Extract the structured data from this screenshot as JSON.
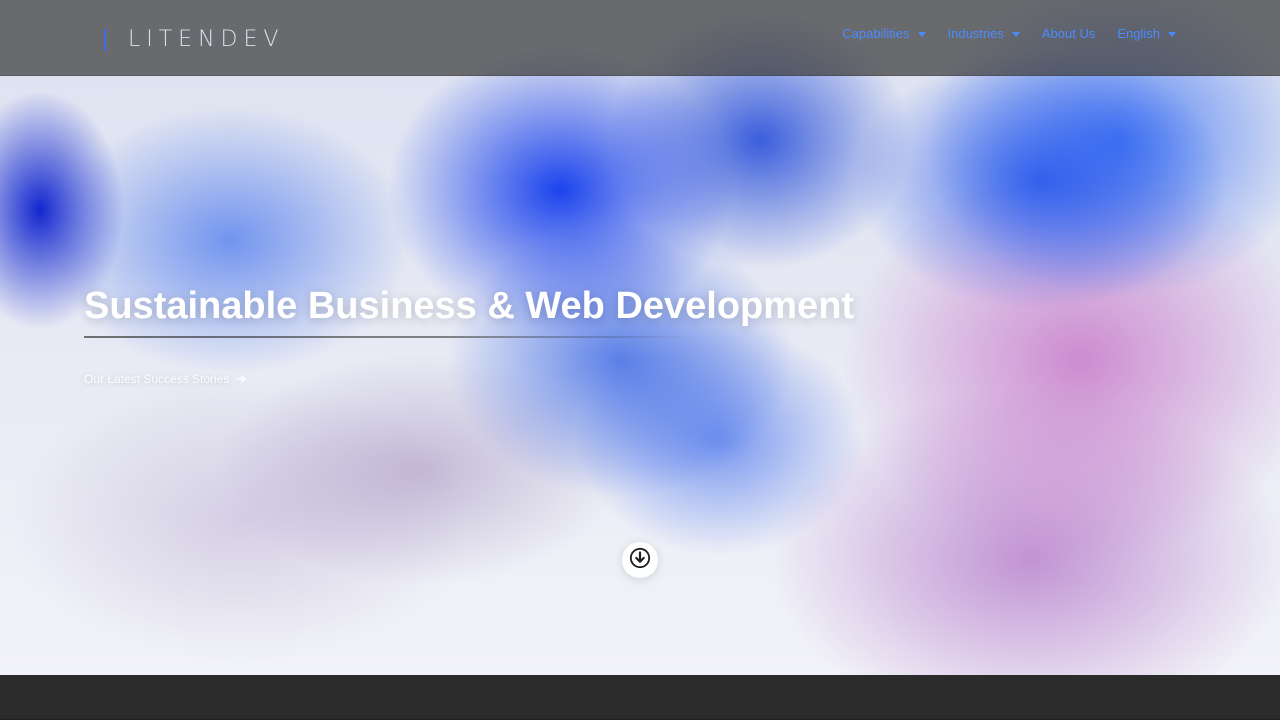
{
  "brand": {
    "logo_text": "LITENDEV",
    "colors": {
      "nav_text": "#4a8cff",
      "hero_text": "#ffffff",
      "nav_bg": "rgba(65,65,65,0.75)",
      "footer_bg": "#2b2b2b"
    }
  },
  "nav": {
    "items": [
      {
        "label": "Capabilities",
        "has_dropdown": true
      },
      {
        "label": "Industries",
        "has_dropdown": true
      },
      {
        "label": "About Us",
        "has_dropdown": false
      },
      {
        "label": "English",
        "has_dropdown": true
      }
    ]
  },
  "hero": {
    "title": "Sustainable Business & Web Development",
    "cta_label": "Our Latest Success Stories",
    "icons": {
      "cta_arrow": "arrow-right-icon",
      "scroll": "arrow-down-circle-icon"
    }
  }
}
